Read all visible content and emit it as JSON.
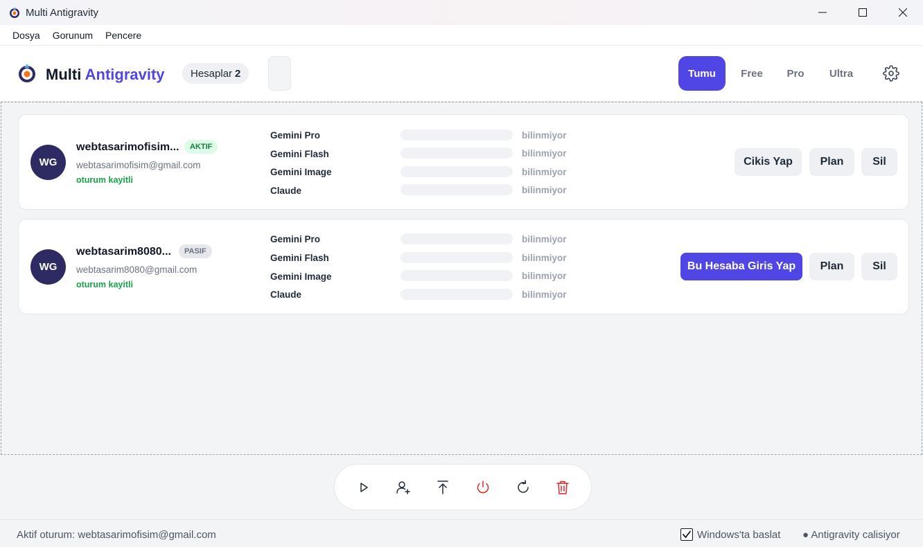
{
  "window": {
    "title": "Multi Antigravity"
  },
  "menu": [
    "Dosya",
    "Gorunum",
    "Pencere"
  ],
  "header": {
    "brand_main": "Multi",
    "brand_accent": "Antigravity",
    "accounts_label": "Hesaplar",
    "accounts_count": "2",
    "filters": [
      {
        "label": "Tumu",
        "active": true
      },
      {
        "label": "Free",
        "active": false
      },
      {
        "label": "Pro",
        "active": false
      },
      {
        "label": "Ultra",
        "active": false
      }
    ]
  },
  "accounts": [
    {
      "initials": "WG",
      "name": "webtasarimofisim...",
      "badge": "AKTIF",
      "email": "webtasarimofisim@gmail.com",
      "session": "oturum kayitli",
      "quotas": [
        {
          "label": "Gemini Pro",
          "status": "bilinmiyor"
        },
        {
          "label": "Gemini Flash",
          "status": "bilinmiyor"
        },
        {
          "label": "Gemini Image",
          "status": "bilinmiyor"
        },
        {
          "label": "Claude",
          "status": "bilinmiyor"
        }
      ],
      "actions": [
        "Cikis Yap",
        "Plan",
        "Sil"
      ]
    },
    {
      "initials": "WG",
      "name": "webtasarim8080...",
      "badge": "PASIF",
      "email": "webtasarim8080@gmail.com",
      "session": "oturum kayitli",
      "quotas": [
        {
          "label": "Gemini Pro",
          "status": "bilinmiyor"
        },
        {
          "label": "Gemini Flash",
          "status": "bilinmiyor"
        },
        {
          "label": "Gemini Image",
          "status": "bilinmiyor"
        },
        {
          "label": "Claude",
          "status": "bilinmiyor"
        }
      ],
      "actions": [
        "Bu Hesaba Giris Yap",
        "Plan",
        "Sil"
      ]
    }
  ],
  "toolbar": {
    "icons": [
      "play-icon",
      "add-user-icon",
      "upload-icon",
      "power-icon",
      "refresh-icon",
      "trash-icon"
    ]
  },
  "status": {
    "active_session": "Aktif oturum: webtasarimofisim@gmail.com",
    "startup_label": "Windows'ta baslat",
    "startup_checked": true,
    "running": "● Antigravity calisiyor"
  },
  "colors": {
    "accent": "#4f46e5",
    "active_badge": "#15803d",
    "danger": "#dc2626",
    "avatar": "#2e2a63"
  }
}
